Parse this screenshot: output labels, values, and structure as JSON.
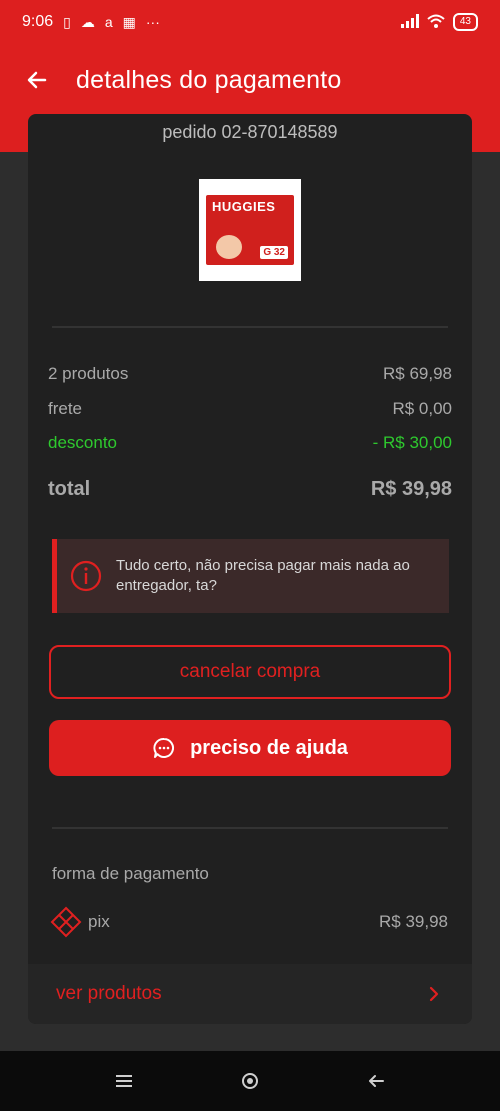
{
  "status_bar": {
    "time": "9:06",
    "battery": "43"
  },
  "header": {
    "title": "detalhes do pagamento"
  },
  "order": {
    "number": "pedido 02-870148589",
    "product_image": {
      "brand": "HUGGIES",
      "size": "G 32"
    }
  },
  "summary": {
    "products_label": "2 produtos",
    "products_value": "R$ 69,98",
    "shipping_label": "frete",
    "shipping_value": "R$ 0,00",
    "discount_label": "desconto",
    "discount_value": "- R$ 30,00",
    "total_label": "total",
    "total_value": "R$ 39,98"
  },
  "notice": {
    "text": "Tudo certo, não precisa pagar mais nada ao entregador, ta?"
  },
  "actions": {
    "cancel_label": "cancelar compra",
    "help_label": "preciso de ajuda"
  },
  "payment": {
    "section_label": "forma de pagamento",
    "method": "pix",
    "amount": "R$ 39,98"
  },
  "footer_link": {
    "label": "ver produtos"
  },
  "colors": {
    "accent": "#dd1f1f",
    "discount": "#2ec92e",
    "card": "#202020",
    "background": "#2d2d2d"
  }
}
